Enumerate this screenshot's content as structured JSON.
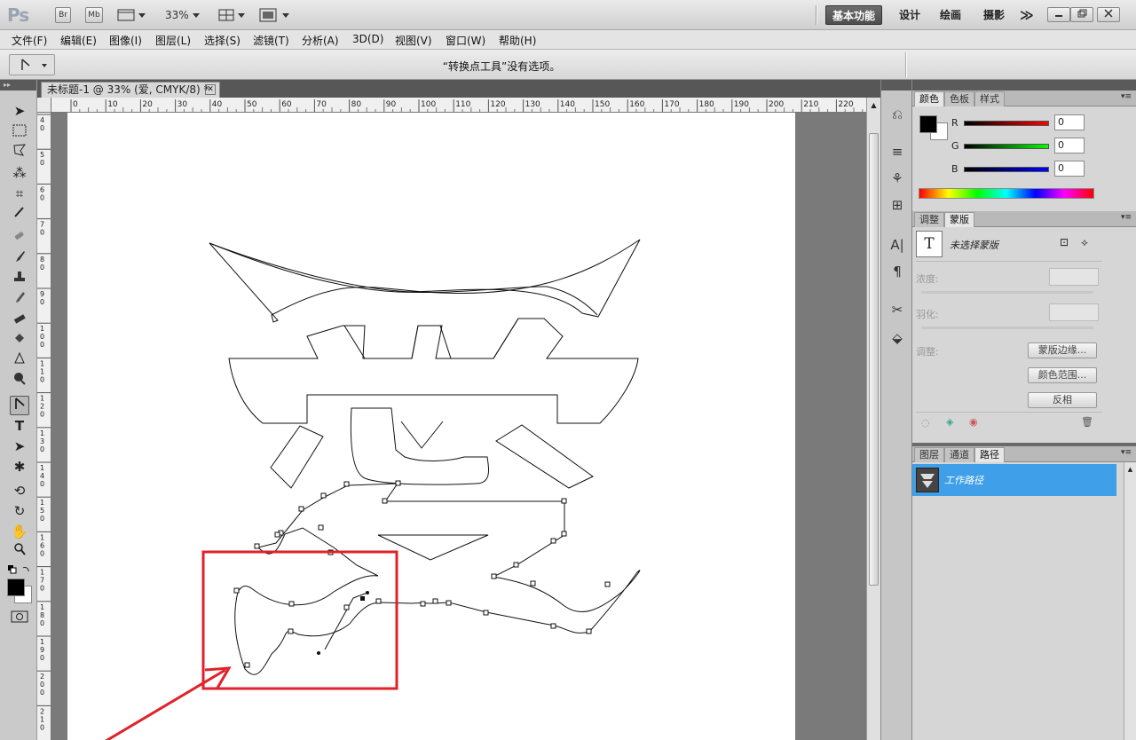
{
  "app": {
    "logo": "Ps",
    "zoom": "33%"
  },
  "appbar": {
    "bridge": "Br",
    "minibridge": "Mb",
    "workspaces": [
      "基本功能",
      "设计",
      "绘画",
      "摄影"
    ],
    "more": "≫"
  },
  "menu": [
    "文件(F)",
    "编辑(E)",
    "图像(I)",
    "图层(L)",
    "选择(S)",
    "滤镜(T)",
    "分析(A)",
    "3D(D)",
    "视图(V)",
    "窗口(W)",
    "帮助(H)"
  ],
  "options": {
    "message": "“转换点工具”没有选项。"
  },
  "document": {
    "tab_title": "未标题-1 @ 33% (爱, CMYK/8) *",
    "ruler_top": [
      "0",
      "10",
      "20",
      "30",
      "40",
      "50",
      "60",
      "70",
      "80",
      "90",
      "100",
      "110",
      "120",
      "130",
      "140",
      "150",
      "160",
      "170",
      "180",
      "190",
      "200",
      "210",
      "220"
    ],
    "ruler_left": [
      "4 0",
      "5 0",
      "6 0",
      "7 0",
      "8 0",
      "9 0",
      "1 0 0",
      "1 1 0",
      "1 2 0",
      "1 3 0",
      "1 4 0",
      "1 5 0",
      "1 6 0",
      "1 7 0",
      "1 8 0",
      "1 9 0",
      "2 0 0",
      "2 1 0"
    ]
  },
  "colors": {
    "accent_red": "#e0222a",
    "selection_blue": "#3f9fe8"
  },
  "color_panel": {
    "tabs": [
      "颜色",
      "色板",
      "样式"
    ],
    "channels": [
      {
        "label": "R",
        "value": "0"
      },
      {
        "label": "G",
        "value": "0"
      },
      {
        "label": "B",
        "value": "0"
      }
    ]
  },
  "masks_panel": {
    "tabs": [
      "调整",
      "蒙版"
    ],
    "status": "未选择蒙版",
    "density_label": "浓度:",
    "feather_label": "羽化:",
    "refine_label": "调整:",
    "buttons": [
      "蒙版边缘...",
      "颜色范围...",
      "反相"
    ]
  },
  "paths_panel": {
    "tabs": [
      "图层",
      "通道",
      "路径"
    ],
    "item": "工作路径"
  }
}
